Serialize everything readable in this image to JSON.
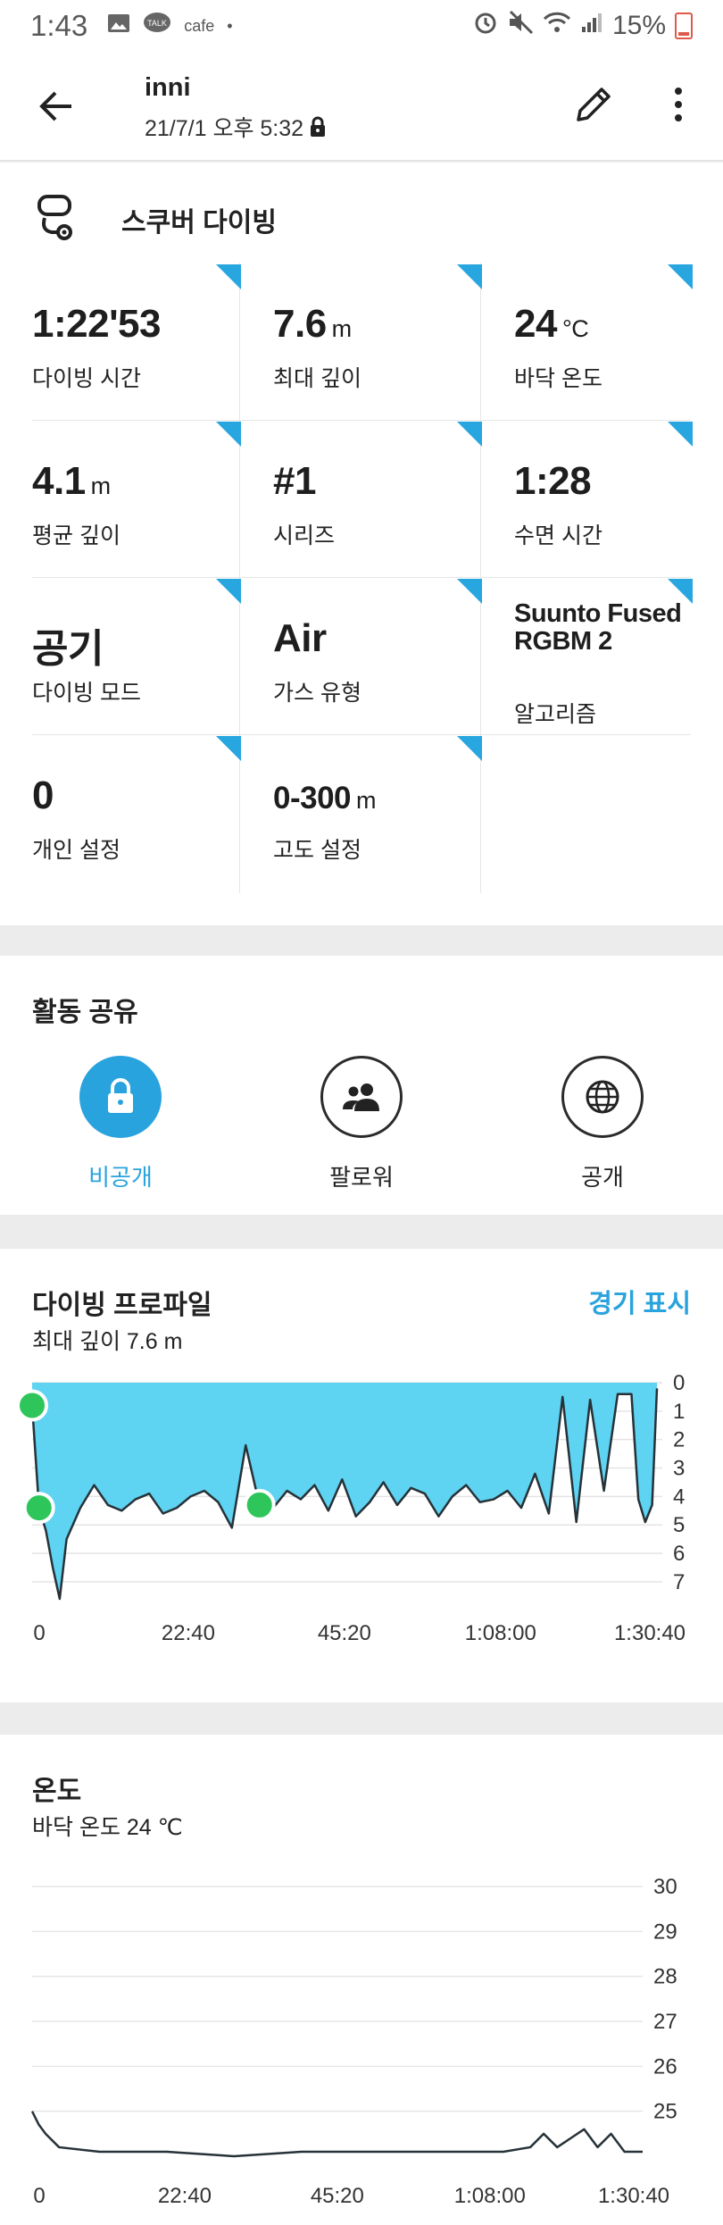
{
  "status_bar": {
    "time": "1:43",
    "battery": "15%",
    "cafe": "cafe",
    "talk": "TALK"
  },
  "header": {
    "user": "inni",
    "datetime": "21/7/1 오후 5:32"
  },
  "activity": {
    "sport": "스쿠버 다이빙"
  },
  "stats": [
    {
      "value": "1:22'53",
      "unit": "",
      "label": "다이빙 시간"
    },
    {
      "value": "7.6",
      "unit": "m",
      "label": "최대 깊이"
    },
    {
      "value": "24",
      "unit": "°C",
      "label": "바닥 온도"
    },
    {
      "value": "4.1",
      "unit": "m",
      "label": "평균 깊이"
    },
    {
      "value": "#1",
      "unit": "",
      "label": "시리즈"
    },
    {
      "value": "1:28",
      "unit": "",
      "label": "수면 시간"
    },
    {
      "value": "공기",
      "unit": "",
      "label": "다이빙 모드"
    },
    {
      "value": "Air",
      "unit": "",
      "label": "가스 유형"
    },
    {
      "value": "Suunto Fused RGBM 2",
      "unit": "",
      "label": "알고리즘"
    },
    {
      "value": "0",
      "unit": "",
      "label": "개인 설정"
    },
    {
      "value": "0-300",
      "unit": "m",
      "label": "고도 설정"
    }
  ],
  "sharing": {
    "title": "활동 공유",
    "options": [
      {
        "label": "비공개",
        "icon": "lock-icon",
        "selected": true
      },
      {
        "label": "팔로워",
        "icon": "followers-icon",
        "selected": false
      },
      {
        "label": "공개",
        "icon": "globe-icon",
        "selected": false
      }
    ]
  },
  "dive_profile": {
    "title": "다이빙 프로파일",
    "subtitle": "최대 깊이 7.6 m",
    "link": "경기 표시"
  },
  "temperature": {
    "title": "온도",
    "subtitle": "바닥 온도 24 ℃"
  },
  "colors": {
    "accent": "#29a3dd",
    "profile_fill": "#5fd3f2",
    "marker": "#2ec65a"
  },
  "chart_data": [
    {
      "type": "area",
      "title": "다이빙 프로파일",
      "x_ticks": [
        "0",
        "22:40",
        "45:20",
        "1:08:00",
        "1:30:40"
      ],
      "y_ticks": [
        "0",
        "1",
        "2",
        "3",
        "4",
        "5",
        "6",
        "7"
      ],
      "ylim": [
        0,
        7.6
      ],
      "y_inverted": true,
      "series": [
        {
          "x_min": [
            0,
            1,
            2,
            3,
            4,
            5,
            7,
            9,
            11,
            13,
            15,
            17,
            19,
            21,
            23,
            25,
            27,
            29,
            31,
            33,
            35,
            37,
            39,
            41,
            43,
            45,
            47,
            49,
            51,
            53,
            55,
            57,
            59,
            61,
            63,
            65,
            67,
            69,
            71,
            73,
            75,
            77,
            79,
            81,
            83,
            85,
            87,
            88,
            89,
            90,
            90.7
          ],
          "depth": [
            0.8,
            4.4,
            5.2,
            6.5,
            7.6,
            5.5,
            4.4,
            3.6,
            4.3,
            4.5,
            4.1,
            3.9,
            4.6,
            4.4,
            4.0,
            3.8,
            4.2,
            5.1,
            2.2,
            4.3,
            4.4,
            3.8,
            4.1,
            3.6,
            4.5,
            3.4,
            4.7,
            4.2,
            3.5,
            4.3,
            3.7,
            3.9,
            4.7,
            4.0,
            3.6,
            4.2,
            4.1,
            3.8,
            4.4,
            3.2,
            4.6,
            0.5,
            4.9,
            0.6,
            3.8,
            0.4,
            0.4,
            4.1,
            4.9,
            4.3,
            0.2
          ]
        }
      ],
      "markers_min": [
        0,
        1,
        33
      ]
    },
    {
      "type": "line",
      "title": "온도",
      "x_ticks": [
        "0",
        "22:40",
        "45:20",
        "1:08:00",
        "1:30:40"
      ],
      "y_ticks": [
        "30",
        "29",
        "28",
        "27",
        "26",
        "25"
      ],
      "ylim": [
        24,
        30
      ],
      "series": [
        {
          "x_min": [
            0,
            1,
            2,
            4,
            10,
            20,
            30,
            40,
            50,
            60,
            70,
            74,
            76,
            78,
            80,
            82,
            84,
            86,
            88,
            90.7
          ],
          "temp": [
            25.0,
            24.7,
            24.5,
            24.2,
            24.1,
            24.1,
            24.0,
            24.1,
            24.1,
            24.1,
            24.1,
            24.2,
            24.5,
            24.2,
            24.4,
            24.6,
            24.2,
            24.5,
            24.1,
            24.1
          ]
        }
      ]
    }
  ]
}
